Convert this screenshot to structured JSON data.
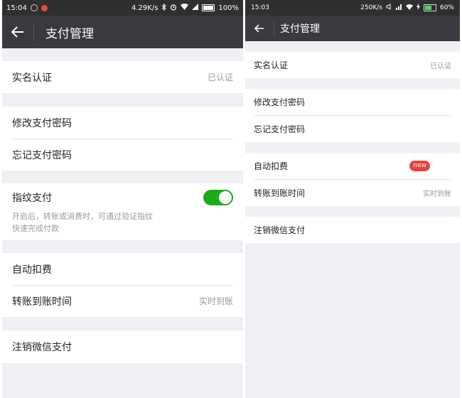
{
  "left": {
    "status": {
      "time": "15:04",
      "speed": "4.29K/s",
      "battery": "100%"
    },
    "title": "支付管理",
    "items": {
      "realname": {
        "label": "实名认证",
        "value": "已认证"
      },
      "change_pwd": {
        "label": "修改支付密码"
      },
      "forgot_pwd": {
        "label": "忘记支付密码"
      },
      "fingerprint": {
        "label": "指纹支付",
        "enabled": true,
        "desc_line1": "开启后，转账或消费时，可通过验证指纹",
        "desc_line2": "快速完成付款"
      },
      "auto_deduct": {
        "label": "自动扣费"
      },
      "arrival_time": {
        "label": "转账到账时间",
        "value": "实时到账"
      },
      "cancel": {
        "label": "注销微信支付"
      }
    }
  },
  "right": {
    "status": {
      "time": "15:03",
      "speed": "250K/s",
      "battery": "60%"
    },
    "title": "支付管理",
    "items": {
      "realname": {
        "label": "实名认证",
        "value": "已认证"
      },
      "change_pwd": {
        "label": "修改支付密码"
      },
      "forgot_pwd": {
        "label": "忘记支付密码"
      },
      "auto_deduct": {
        "label": "自动扣费",
        "badge": "new"
      },
      "arrival_time": {
        "label": "转账到账时间",
        "value": "实时到账"
      },
      "cancel": {
        "label": "注销微信支付"
      }
    }
  },
  "colors": {
    "titlebar": "#393a3f",
    "statusbar": "#2f2f31",
    "background": "#efeff4",
    "toggle_on": "#1aad19",
    "badge": "#e64340"
  }
}
